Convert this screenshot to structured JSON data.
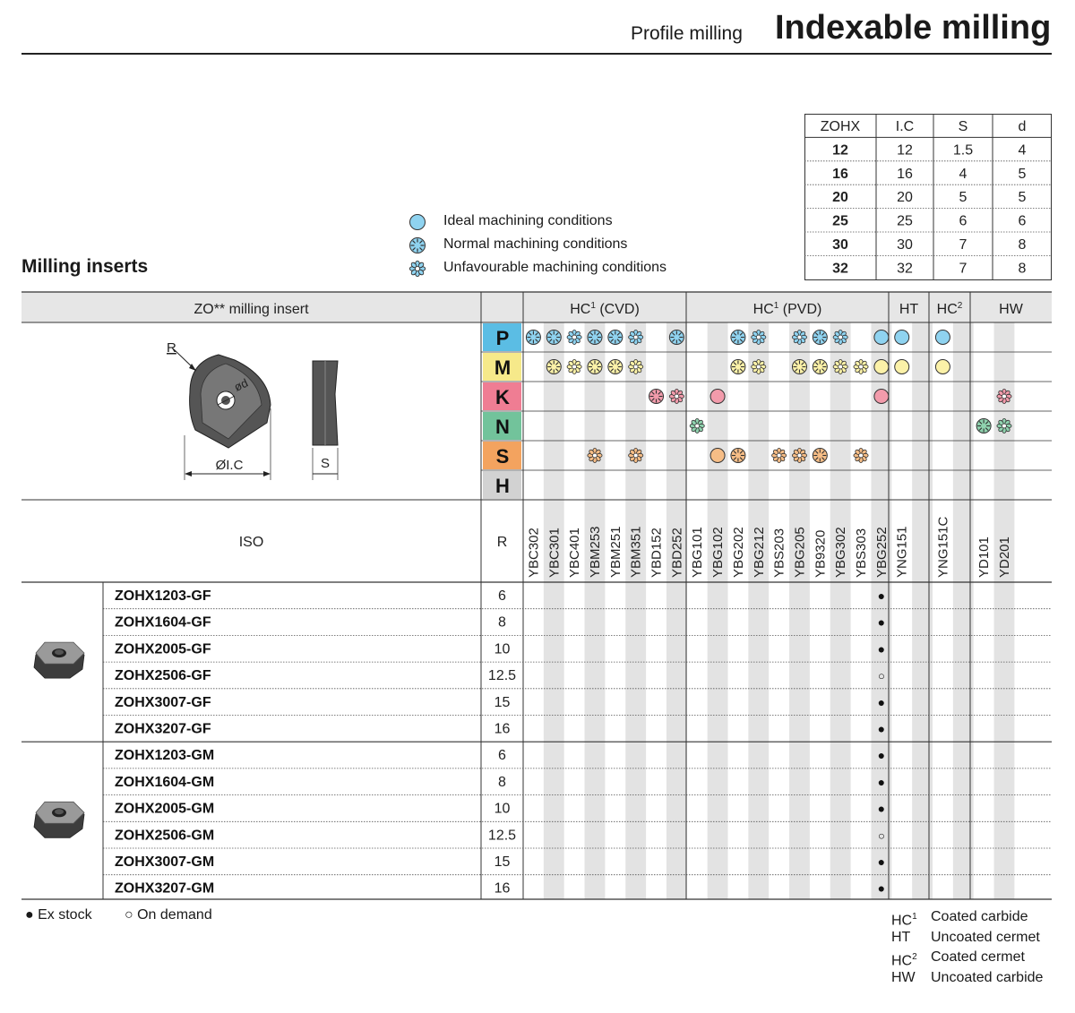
{
  "header": {
    "subtitle": "Profile milling",
    "title": "Indexable milling"
  },
  "section_title": "Milling inserts",
  "legend": [
    {
      "icon": "ideal-circle",
      "label": "Ideal machining conditions"
    },
    {
      "icon": "normal-gear",
      "label": "Normal machining conditions"
    },
    {
      "icon": "unfavourable-flower",
      "label": "Unfavourable machining conditions"
    }
  ],
  "dim_table": {
    "headers": [
      "ZOHX",
      "I.C",
      "S",
      "d"
    ],
    "rows": [
      [
        "12",
        "12",
        "1.5",
        "4"
      ],
      [
        "16",
        "16",
        "4",
        "5"
      ],
      [
        "20",
        "20",
        "5",
        "5"
      ],
      [
        "25",
        "25",
        "6",
        "6"
      ],
      [
        "30",
        "30",
        "7",
        "8"
      ],
      [
        "32",
        "32",
        "7",
        "8"
      ]
    ]
  },
  "main_table": {
    "insert_header": "ZO** milling insert",
    "iso_label": "ISO",
    "r_label": "R",
    "group_headers": [
      {
        "base": "HC",
        "sup": "1",
        "rest": " (CVD)"
      },
      {
        "base": "HC",
        "sup": "1",
        "rest": " (PVD)"
      },
      {
        "base": "HT",
        "sup": "",
        "rest": ""
      },
      {
        "base": "HC",
        "sup": "2",
        "rest": ""
      },
      {
        "base": "HW",
        "sup": "",
        "rest": ""
      }
    ],
    "materials": [
      {
        "letter": "P",
        "color": "#5bbde4"
      },
      {
        "letter": "M",
        "color": "#f6e98a"
      },
      {
        "letter": "K",
        "color": "#ef7d93"
      },
      {
        "letter": "N",
        "color": "#72c39b"
      },
      {
        "letter": "S",
        "color": "#f3a35f"
      },
      {
        "letter": "H",
        "color": "#d2d2d2"
      }
    ],
    "grades": [
      "YBC302",
      "YBC301",
      "YBC401",
      "YBM253",
      "YBM251",
      "YBM351",
      "YBD152",
      "YBD252",
      "YBG101",
      "YBG102",
      "YBG202",
      "YBG212",
      "YBS203",
      "YBG205",
      "YB9320",
      "YBG302",
      "YBS303",
      "YBG252",
      "YNG151",
      "",
      "YNG151C",
      "",
      "YD101",
      "YD201",
      ""
    ],
    "diagram_labels": {
      "r": "R",
      "d": "ød",
      "ic": "ØI.C",
      "s": "S"
    },
    "row_groups": [
      {
        "image": "insert-gf",
        "rows": [
          {
            "iso": "ZOHX1203-GF",
            "r": "6",
            "stock": "●"
          },
          {
            "iso": "ZOHX1604-GF",
            "r": "8",
            "stock": "●"
          },
          {
            "iso": "ZOHX2005-GF",
            "r": "10",
            "stock": "●"
          },
          {
            "iso": "ZOHX2506-GF",
            "r": "12.5",
            "stock": "○"
          },
          {
            "iso": "ZOHX3007-GF",
            "r": "15",
            "stock": "●"
          },
          {
            "iso": "ZOHX3207-GF",
            "r": "16",
            "stock": "●"
          }
        ]
      },
      {
        "image": "insert-gm",
        "rows": [
          {
            "iso": "ZOHX1203-GM",
            "r": "6",
            "stock": "●"
          },
          {
            "iso": "ZOHX1604-GM",
            "r": "8",
            "stock": "●"
          },
          {
            "iso": "ZOHX2005-GM",
            "r": "10",
            "stock": "●"
          },
          {
            "iso": "ZOHX2506-GM",
            "r": "12.5",
            "stock": "○"
          },
          {
            "iso": "ZOHX3007-GM",
            "r": "15",
            "stock": "●"
          },
          {
            "iso": "ZOHX3207-GM",
            "r": "16",
            "stock": "●"
          }
        ]
      }
    ]
  },
  "footer": {
    "ex_stock": "● Ex stock",
    "on_demand": "○ On demand"
  },
  "grade_legend": [
    {
      "base": "HC",
      "sup": "1",
      "desc": "Coated carbide"
    },
    {
      "base": "HT",
      "sup": "",
      "desc": "Uncoated cermet"
    },
    {
      "base": "HC",
      "sup": "2",
      "desc": "Coated cermet"
    },
    {
      "base": "HW",
      "sup": "",
      "desc": "Uncoated carbide"
    }
  ]
}
